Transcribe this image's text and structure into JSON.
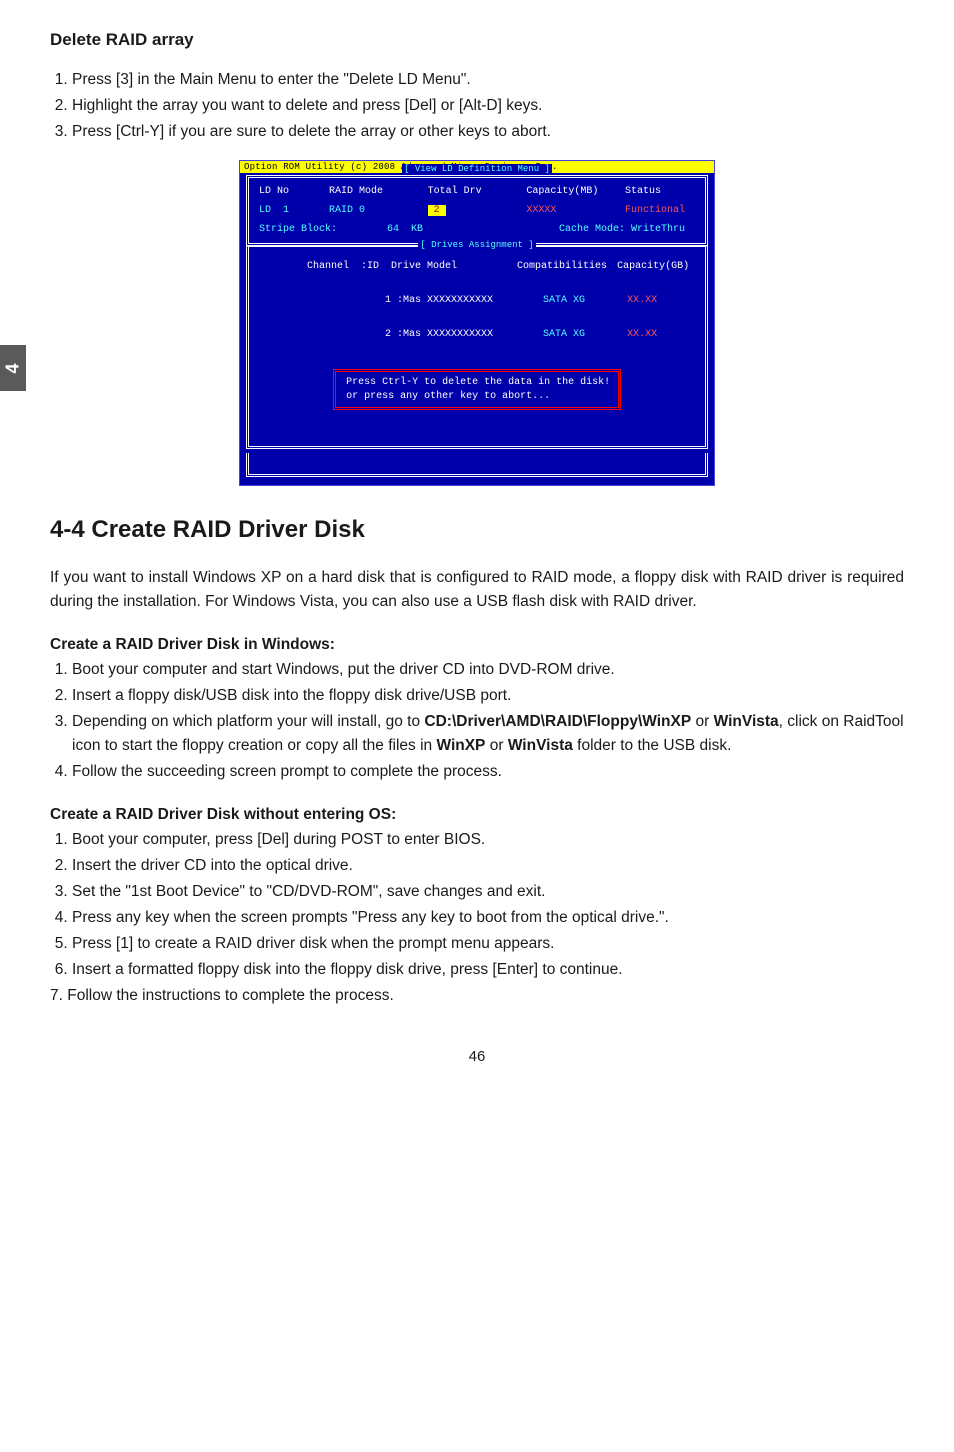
{
  "side_tab": "4",
  "delete_section": {
    "heading": "Delete RAID array",
    "steps": [
      "Press [3] in the Main Menu to enter the \"Delete LD Menu\".",
      "Highlight the array you want to delete and press [Del] or [Alt-D] keys.",
      "Press [Ctrl-Y] if you are sure to delete the array or other keys to abort."
    ]
  },
  "bios": {
    "titlebar": "Option ROM Utility (c) 2008 Advanced Micro Devices, Inc.",
    "band1": "[ View LD Definition Menu ]",
    "hdr": {
      "c1": "LD No",
      "c2": "RAID Mode",
      "c3": "Total Drv",
      "c4": "Capacity(MB)",
      "c5": "Status"
    },
    "row": {
      "c1": "LD  1",
      "c2": "RAID 0",
      "c3": "2",
      "c4": "XXXXX",
      "c5": "Functional"
    },
    "stripe": {
      "label": "Stripe Block:",
      "val": "64  KB",
      "cache_label": "Cache Mode:",
      "cache_val": "WriteThru"
    },
    "band2": "[ Drives Assignment ]",
    "drives_hdr": {
      "c1": "Channel  :ID  Drive Model",
      "c2": "Compatibilities",
      "c3": "Capacity(GB)"
    },
    "drives": [
      {
        "c1": "             1 :Mas XXXXXXXXXXX",
        "c2": "SATA XG",
        "c3": "XX.XX"
      },
      {
        "c1": "             2 :Mas XXXXXXXXXXX",
        "c2": "SATA XG",
        "c3": "XX.XX"
      }
    ],
    "popup_l1": "Press Ctrl-Y to delete the data in the disk!",
    "popup_l2": "or press any other key to abort..."
  },
  "create_section": {
    "title": "4-4 Create RAID Driver Disk",
    "intro": "If you want to install Windows XP on a hard disk that is configured to RAID mode, a floppy disk with RAID driver is required during the installation. For Windows Vista, you can also use a USB flash disk with RAID driver.",
    "sub1_heading": "Create a RAID Driver Disk in Windows:",
    "sub1_steps": {
      "s1": "Boot your computer and start Windows, put the driver CD into DVD-ROM drive.",
      "s2": "Insert a floppy disk/USB disk into the floppy disk drive/USB port.",
      "s3_pre": "Depending on which platform your will install, go to ",
      "s3_bold1": "CD:\\Driver\\AMD\\RAID\\Floppy\\WinXP",
      "s3_mid1": " or ",
      "s3_bold2": "WinVista",
      "s3_mid2": ", click on RaidTool icon to start the floppy creation or copy all the files in ",
      "s3_bold3": "WinXP",
      "s3_mid3": " or ",
      "s3_bold4": "WinVista",
      "s3_post": " folder to the USB disk.",
      "s4": "Follow the succeeding screen prompt to complete the process."
    },
    "sub2_heading": "Create a RAID Driver Disk without entering OS:",
    "sub2_steps": [
      "Boot your computer, press [Del] during POST to enter BIOS.",
      "Insert the driver CD into the optical drive.",
      "Set the \"1st Boot Device\" to \"CD/DVD-ROM\", save changes and exit.",
      "Press any key when the screen prompts \"Press any key to boot from the optical drive.\".",
      "Press [1] to create a RAID driver disk when the prompt menu appears.",
      "Insert a formatted floppy disk into the floppy disk drive, press [Enter] to continue."
    ],
    "sub2_step7": "7. Follow the instructions to complete the process."
  },
  "page_number": "46"
}
